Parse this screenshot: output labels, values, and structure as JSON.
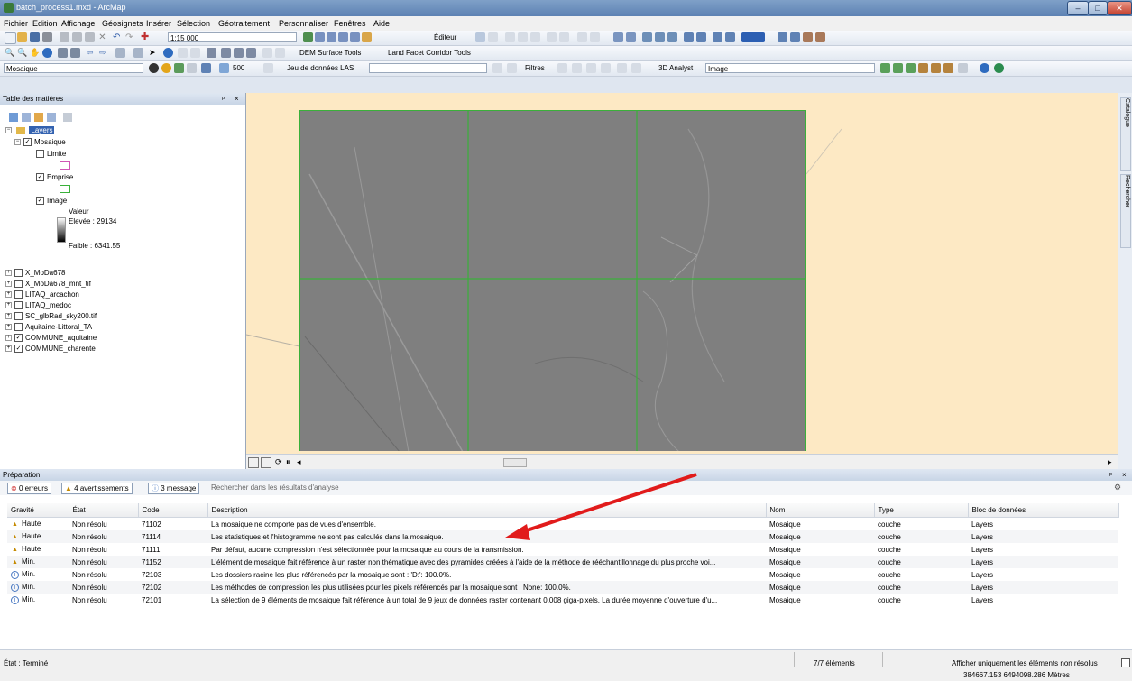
{
  "window": {
    "title": "batch_process1.mxd - ArcMap"
  },
  "menu": [
    "Fichier",
    "Edition",
    "Affichage",
    "Géosignets",
    "Insérer",
    "Sélection",
    "Géotraitement",
    "Personnaliser",
    "Fenêtres",
    "Aide"
  ],
  "toolbar": {
    "scale": "1:15 000",
    "editor_label": "Éditeur",
    "dem_tools": "DEM Surface Tools",
    "land_facet_tools": "Land Facet Corridor Tools",
    "layer_combo": "Mosaique",
    "value_500": "500",
    "las_dataset": "Jeu de données LAS",
    "filters": "Filtres",
    "analyst_3d": "3D Analyst",
    "analyst_layer": "Image"
  },
  "toc": {
    "title": "Table des matières",
    "root": "Layers",
    "mosaic": "Mosaique",
    "limite": "Limite",
    "emprise": "Emprise",
    "image": "Image",
    "valeur": "Valeur",
    "high": "Elevée : 29134",
    "low": "Faible : 6341.55",
    "layers": [
      "X_MoDa678",
      "X_MoDa678_mnt_tif",
      "LITAQ_arcachon",
      "LITAQ_medoc",
      "SC_glbRad_sky200.tif",
      "Aquitaine-Littoral_TA",
      "COMMUNE_aquitaine",
      "COMMUNE_charente"
    ]
  },
  "side_tabs": {
    "catalog": "Catalogue",
    "search": "Rechercher"
  },
  "results": {
    "title": "Préparation",
    "errors": "0 erreurs",
    "warnings": "4 avertissements",
    "messages": "3 message",
    "search": "Rechercher dans les résultats d'analyse",
    "columns": [
      "Gravité",
      "État",
      "Code",
      "Description",
      "Nom",
      "Type",
      "Bloc de données"
    ],
    "rows": [
      {
        "sev": "Haute",
        "kind": "warn",
        "state": "Non résolu",
        "code": "71102",
        "desc": "La mosaique ne comporte pas de vues d'ensemble.",
        "name": "Mosaique",
        "type": "couche",
        "block": "Layers"
      },
      {
        "sev": "Haute",
        "kind": "warn",
        "state": "Non résolu",
        "code": "71114",
        "desc": "Les statistiques et l'histogramme ne sont pas calculés dans la mosaique.",
        "name": "Mosaique",
        "type": "couche",
        "block": "Layers"
      },
      {
        "sev": "Haute",
        "kind": "warn",
        "state": "Non résolu",
        "code": "71111",
        "desc": "Par défaut, aucune compression n'est sélectionnée pour la mosaique au cours de la transmission.",
        "name": "Mosaique",
        "type": "couche",
        "block": "Layers"
      },
      {
        "sev": "Min.",
        "kind": "warn",
        "state": "Non résolu",
        "code": "71152",
        "desc": "L'élément de mosaique fait référence à un raster non thématique avec des pyramides créées à l'aide de la méthode de rééchantillonnage du plus proche voi...",
        "name": "Mosaique",
        "type": "couche",
        "block": "Layers"
      },
      {
        "sev": "Min.",
        "kind": "info",
        "state": "Non résolu",
        "code": "72103",
        "desc": "Les dossiers racine les plus référencés par la mosaique sont : 'D:': 100.0%.",
        "name": "Mosaique",
        "type": "couche",
        "block": "Layers"
      },
      {
        "sev": "Min.",
        "kind": "info",
        "state": "Non résolu",
        "code": "72102",
        "desc": "Les méthodes de compression les plus utilisées pour les pixels référencés par la mosaique sont : None: 100.0%.",
        "name": "Mosaique",
        "type": "couche",
        "block": "Layers"
      },
      {
        "sev": "Min.",
        "kind": "info",
        "state": "Non résolu",
        "code": "72101",
        "desc": "La sélection de 9 éléments de mosaique fait référence à un total de 9 jeux de données raster contenant 0.008 giga-pixels. La durée moyenne d'ouverture d'u...",
        "name": "Mosaique",
        "type": "couche",
        "block": "Layers"
      }
    ],
    "count": "7/7 éléments",
    "unresolved_toggle": "Afficher uniquement les éléments non résolus"
  },
  "status": {
    "state": "État : Terminé",
    "coords": "384667.153  6494098.286 Mètres"
  },
  "colors": {
    "raster_grid": "#3ab03a",
    "map_bg": "#fde9c4",
    "arrow": "#e11b1b"
  }
}
